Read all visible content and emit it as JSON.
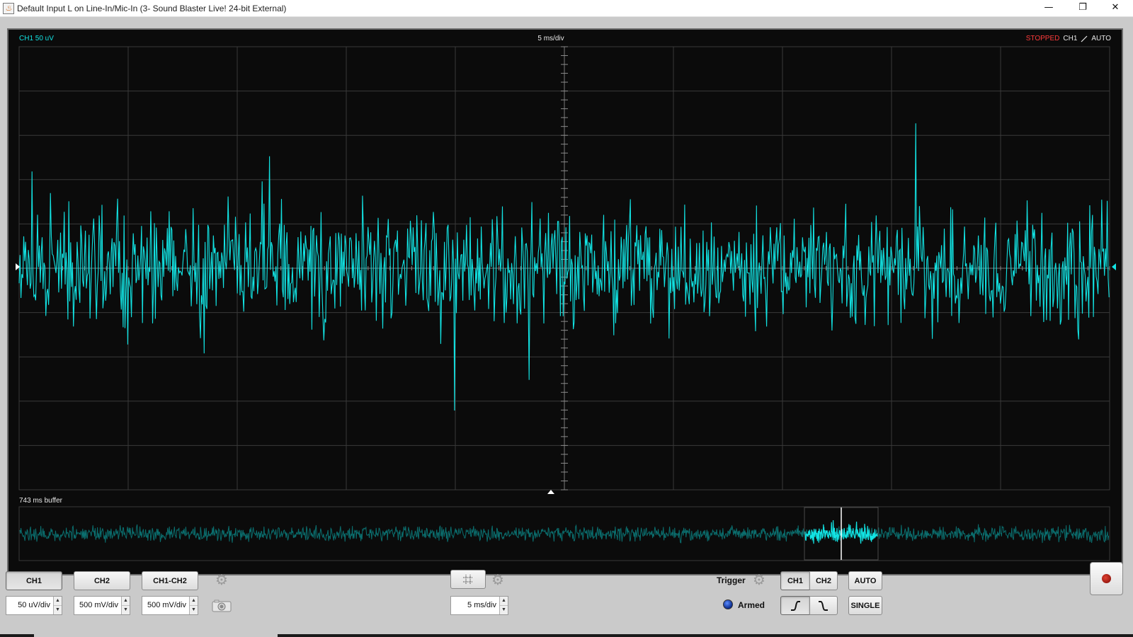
{
  "window": {
    "title": "Default Input L on Line-In/Mic-In (3- Sound Blaster Live! 24-bit External)",
    "minimize_symbol": "—",
    "restore_symbol": "❐",
    "close_symbol": "✕",
    "icon": "java-cup-icon"
  },
  "scope": {
    "channel_label": "CH1 50 uV",
    "timebase_label": "5 ms/div",
    "status": "STOPPED",
    "trigger_source": "CH1",
    "trigger_mode": "AUTO",
    "buffer_label": "743 ms buffer"
  },
  "colors": {
    "trace": "#12e3e3",
    "trace_dim": "#0b6e6e",
    "grid": "#3a3a3a",
    "status_stopped": "#ff3b3b",
    "background": "#0b0b0b"
  },
  "controls": {
    "ch1_label": "CH1",
    "ch2_label": "CH2",
    "diff_label": "CH1-CH2",
    "ch1_scale": "50 uV/div",
    "ch2_scale": "500 mV/div",
    "diff_scale": "500 mV/div",
    "timebase": "5 ms/div",
    "trigger_label": "Trigger",
    "armed_label": "Armed",
    "trigger_ch1": "CH1",
    "trigger_ch2": "CH2",
    "auto_label": "AUTO",
    "single_label": "SINGLE"
  },
  "icons": {
    "settings": "gear-icon",
    "camera": "camera-icon",
    "grid": "grid-icon",
    "rising_edge": "rising-edge-icon",
    "falling_edge": "falling-edge-icon",
    "record": "record-icon"
  }
}
